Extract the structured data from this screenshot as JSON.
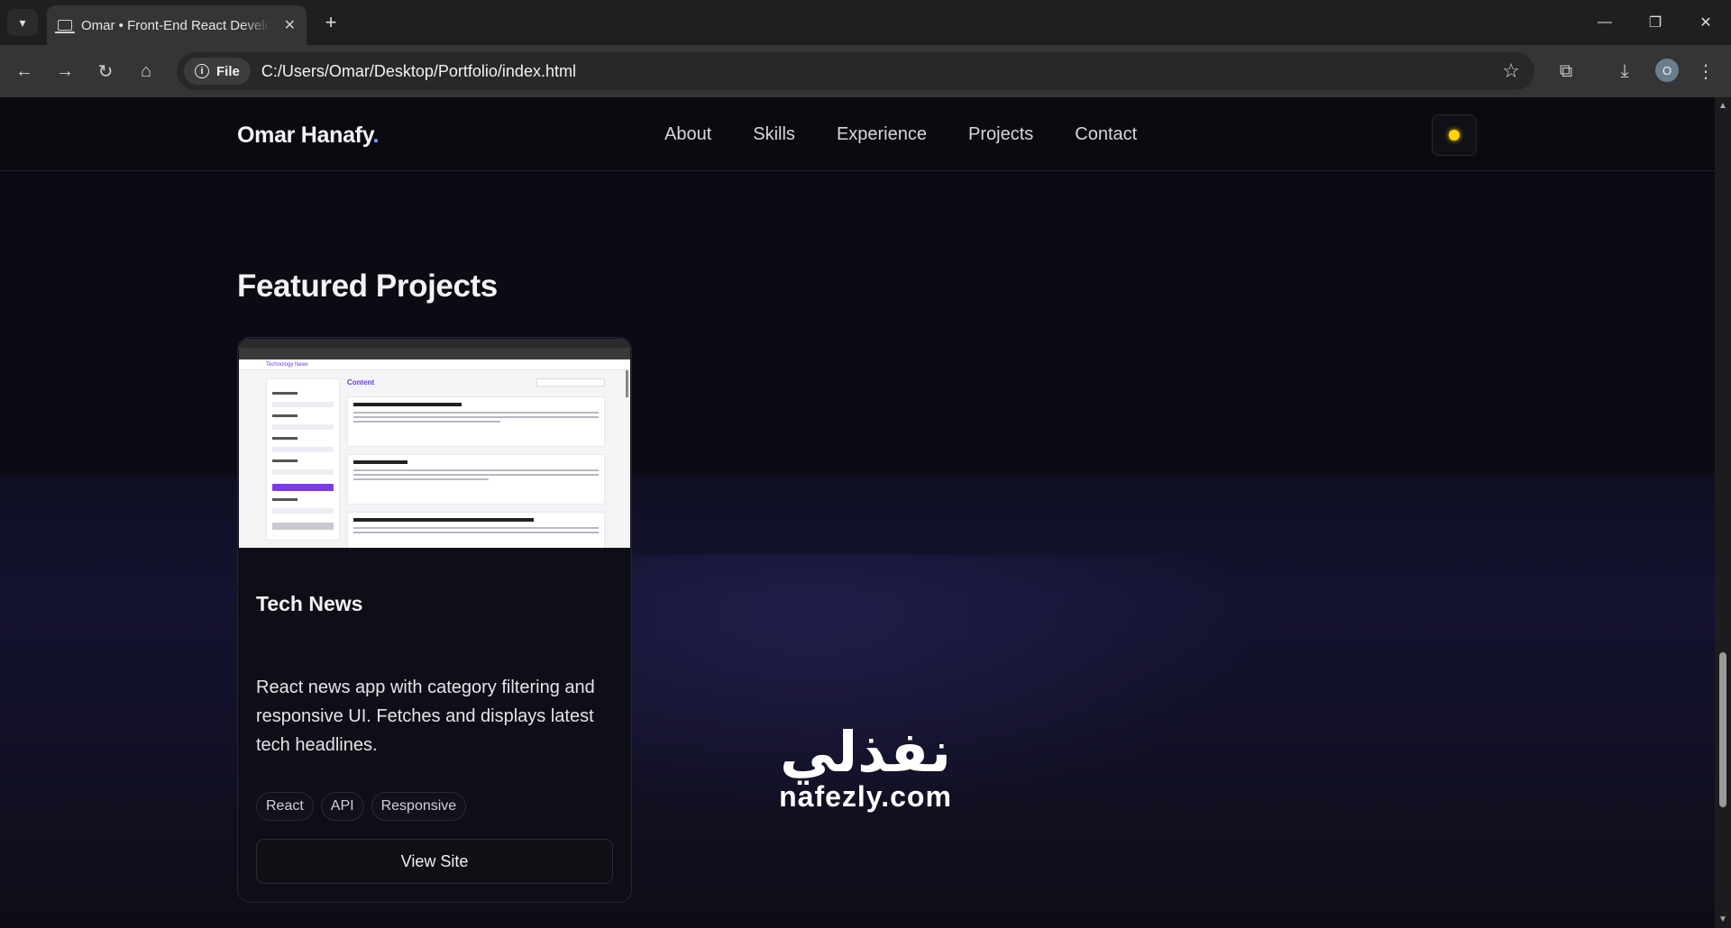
{
  "browser": {
    "tab_title": "Omar • Front-End React Developer",
    "site_chip_label": "File",
    "url": "C:/Users/Omar/Desktop/Portfolio/index.html",
    "profile_initial": "O"
  },
  "site": {
    "logo": "Omar Hanafy",
    "logo_dot": ".",
    "nav": [
      "About",
      "Skills",
      "Experience",
      "Projects",
      "Contact"
    ]
  },
  "section": {
    "title": "Featured Projects"
  },
  "project": {
    "title": "Tech News",
    "description": "React news app with category filtering and responsive UI. Fetches and displays latest tech headlines.",
    "tags": [
      "React",
      "API",
      "Responsive"
    ],
    "view_label": "View Site",
    "thumbnail": {
      "header": "Technology News",
      "content_title": "Content"
    }
  },
  "watermark": {
    "arabic": "نفذلي",
    "latin": "nafezly.com"
  },
  "colors": {
    "accent": "#7aa7ff",
    "theme_sun": "#ffd400",
    "thumb_accent": "#7c3aed"
  },
  "icons": {
    "tab_menu": "chevron-down-icon",
    "tab_favicon": "laptop-icon",
    "tab_close": "close-icon",
    "new_tab": "plus-icon",
    "back": "arrow-left-icon",
    "forward": "arrow-right-icon",
    "reload": "reload-icon",
    "home": "home-icon",
    "info": "info-icon",
    "bookmark": "star-icon",
    "extensions": "puzzle-icon",
    "downloads": "download-icon",
    "menu": "kebab-icon",
    "theme_toggle": "sun-icon"
  }
}
